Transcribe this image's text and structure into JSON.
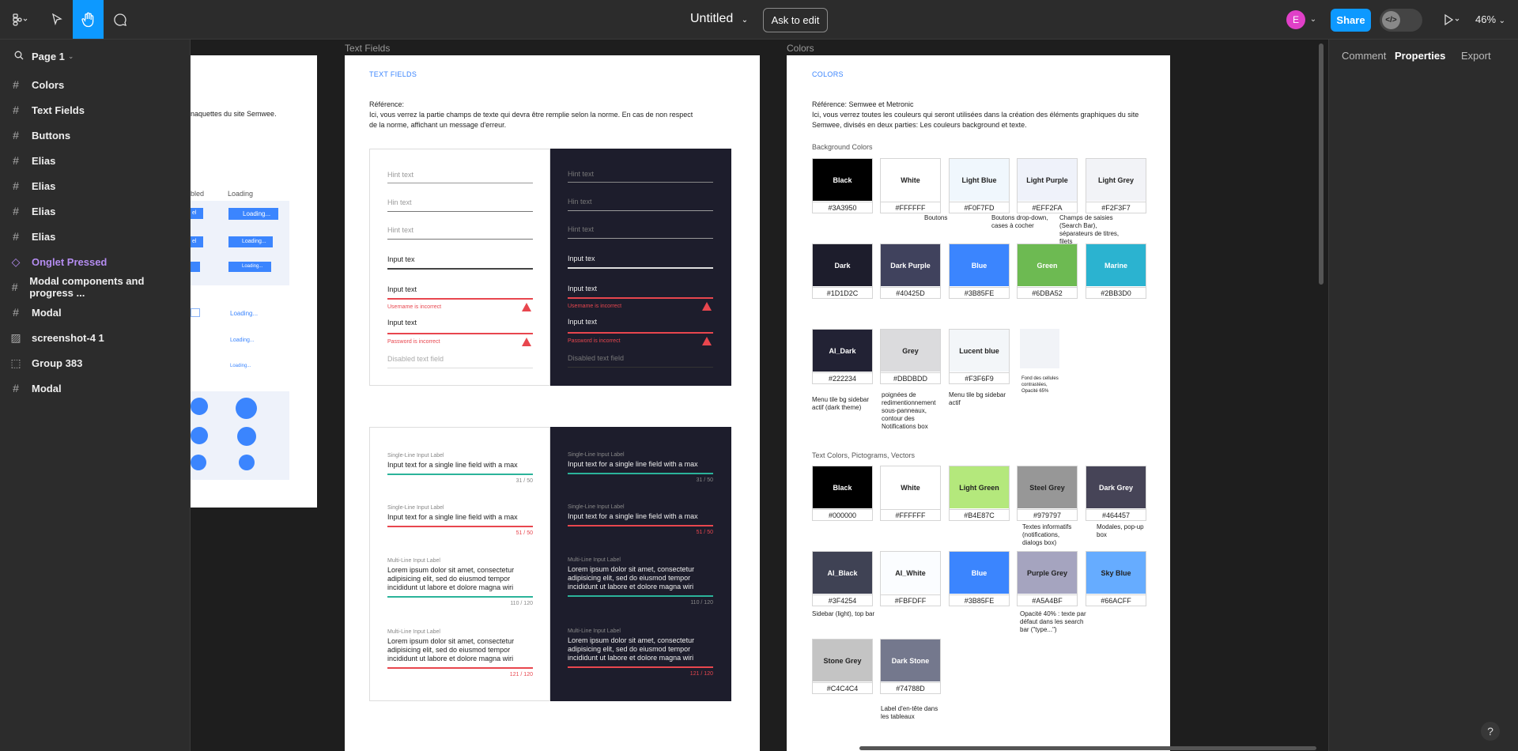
{
  "topbar": {
    "title": "Untitled",
    "ask_to_edit": "Ask to edit",
    "avatar_initial": "E",
    "share": "Share",
    "zoom": "46%"
  },
  "sidebar": {
    "page": "Page 1",
    "layers": [
      {
        "label": "Colors",
        "icon": "frame-icon"
      },
      {
        "label": "Text Fields",
        "icon": "frame-icon"
      },
      {
        "label": "Buttons",
        "icon": "frame-icon"
      },
      {
        "label": "Elias",
        "icon": "frame-icon"
      },
      {
        "label": "Elias",
        "icon": "frame-icon"
      },
      {
        "label": "Elias",
        "icon": "frame-icon"
      },
      {
        "label": "Elias",
        "icon": "frame-icon"
      },
      {
        "label": "Onglet Pressed",
        "icon": "component-icon"
      },
      {
        "label": "Modal components and progress ...",
        "icon": "frame-icon"
      },
      {
        "label": "Modal",
        "icon": "frame-icon"
      },
      {
        "label": "screenshot-4 1",
        "icon": "image-icon"
      },
      {
        "label": "Group 383",
        "icon": "group-icon"
      },
      {
        "label": "Modal",
        "icon": "frame-icon"
      }
    ]
  },
  "right_panel": {
    "tabs": [
      "Comment",
      "Properties",
      "Export"
    ]
  },
  "buttons_frame": {
    "desc": "naquettes du site Semwee.",
    "col1": "bled",
    "col2": "Loading",
    "loading": [
      "Loading...",
      "Loading...",
      "Loading...",
      "Loading...",
      "Loading...",
      "Loading..."
    ],
    "btn_stub": "el"
  },
  "text_fields": {
    "frame_label": "Text Fields",
    "heading": "TEXT FIELDS",
    "ref": "Référence:",
    "desc": "Ici, vous verrez la partie champs de texte qui devra  être  remplie selon la norme. En cas de non respect de la norme, affichant un message d'erreur.",
    "hint": "Hint text",
    "hint_cursor": "Hin text",
    "input_partial": "Input tex",
    "input": "Input text",
    "err_user": "Username  is incorrect",
    "err_pass": "Password is incorrect",
    "disabled": "Disabled text field",
    "single_label": "Single-Line Input Label",
    "single_value": "Input text for a single line field with a max",
    "count_ok": "31 / 50",
    "count_err": "51 / 50",
    "multi_label": "Multi-Line Input Label",
    "multi_value": "Lorem ipsum dolor sit amet, consectetur adipisicing elit, sed do eiusmod tempor incididunt ut labore et dolore magna wiri",
    "multi_count_ok": "110 / 120",
    "multi_count_err": "121 / 120"
  },
  "colors": {
    "frame_label": "Colors",
    "heading": "COLORS",
    "ref": "Référence: Semwee et Metronic",
    "desc": "Ici, vous verrez toutes les couleurs qui seront utilisées dans la création des éléments graphiques du site Semwee, divisés en deux parties: Les couleurs background et texte.",
    "bg_title": "Background Colors",
    "text_title": "Text Colors, Pictograms, Vectors",
    "bg_swatches": [
      {
        "name": "Black",
        "hex": "#3A3950",
        "color": "#000000",
        "text": "#ffffff"
      },
      {
        "name": "White",
        "hex": "#FFFFFF",
        "color": "#ffffff",
        "text": "#222222"
      },
      {
        "name": "Light Blue",
        "hex": "#F0F7FD",
        "color": "#f0f7fd",
        "text": "#222222"
      },
      {
        "name": "Light Purple",
        "hex": "#EFF2FA",
        "color": "#eff2fa",
        "text": "#222222"
      },
      {
        "name": "Light Grey",
        "hex": "#F2F3F7",
        "color": "#f2f3f7",
        "text": "#222222"
      },
      {
        "name": "Dark",
        "hex": "#1D1D2C",
        "color": "#1d1d2c",
        "text": "#ffffff"
      },
      {
        "name": "Dark Purple",
        "hex": "#40425D",
        "color": "#40425d",
        "text": "#ffffff"
      },
      {
        "name": "Blue",
        "hex": "#3B85FE",
        "color": "#3b85fe",
        "text": "#ffffff"
      },
      {
        "name": "Green",
        "hex": "#6DBA52",
        "color": "#6dba52",
        "text": "#ffffff"
      },
      {
        "name": "Marine",
        "hex": "#2BB3D0",
        "color": "#2bb3d0",
        "text": "#ffffff"
      },
      {
        "name": "AI_Dark",
        "hex": "#222234",
        "color": "#222234",
        "text": "#ffffff"
      },
      {
        "name": "Grey",
        "hex": "#DBDBDD",
        "color": "#dbdbdd",
        "text": "#222222"
      },
      {
        "name": "Lucent blue",
        "hex": "#F3F6F9",
        "color": "#f3f6f9",
        "text": "#222222"
      }
    ],
    "bg_notes": [
      "Boutons",
      "Boutons drop-down, cases à cocher",
      "Champs de saisies (Search Bar), séparateurs de titres, filets",
      "Menu tile bg sidebar actif (dark theme)",
      "poignées de redimentionnement sous-panneaux, contour des Notifications box",
      "Menu tile bg sidebar actif",
      "Fond des cellules contrastées, Opacité 65%"
    ],
    "text_swatches": [
      {
        "name": "Black",
        "hex": "#000000",
        "color": "#000000",
        "text": "#ffffff"
      },
      {
        "name": "White",
        "hex": "#FFFFFF",
        "color": "#ffffff",
        "text": "#222222"
      },
      {
        "name": "Light Green",
        "hex": "#B4E87C",
        "color": "#b4e87c",
        "text": "#222222"
      },
      {
        "name": "Steel Grey",
        "hex": "#979797",
        "color": "#979797",
        "text": "#222222"
      },
      {
        "name": "Dark Grey",
        "hex": "#464457",
        "color": "#464457",
        "text": "#ffffff"
      },
      {
        "name": "AI_Black",
        "hex": "#3F4254",
        "color": "#3f4254",
        "text": "#ffffff"
      },
      {
        "name": "AI_White",
        "hex": "#FBFDFF",
        "color": "#fbfdff",
        "text": "#222222"
      },
      {
        "name": "Blue",
        "hex": "#3B85FE",
        "color": "#3b85fe",
        "text": "#ffffff"
      },
      {
        "name": "Purple Grey",
        "hex": "#A5A4BF",
        "color": "#a5a4bf",
        "text": "#222222"
      },
      {
        "name": "Sky Blue",
        "hex": "#66ACFF",
        "color": "#66acff",
        "text": "#222222"
      },
      {
        "name": "Stone Grey",
        "hex": "#C4C4C4",
        "color": "#c4c4c4",
        "text": "#222222"
      },
      {
        "name": "Dark Stone",
        "hex": "#74788D",
        "color": "#74788d",
        "text": "#ffffff"
      }
    ],
    "text_notes": [
      "Textes informatifs (notifications, dialogs box)",
      "Modales, pop-up box",
      "Sidebar (light), top bar",
      "Opacité 40% : texte par défaut dans les search bar (\"type...\")",
      "Label d'en-tête dans les tableaux"
    ]
  }
}
